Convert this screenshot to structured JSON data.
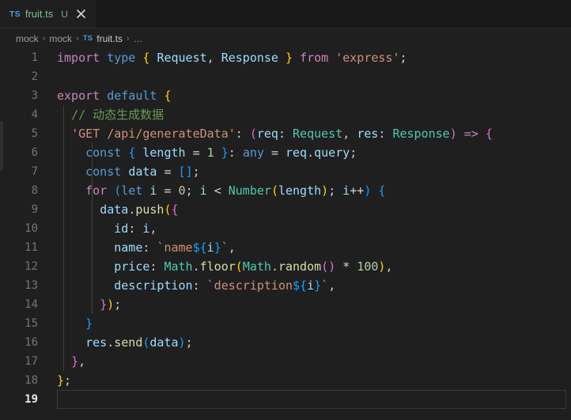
{
  "tab": {
    "file_type_badge": "TS",
    "label": "fruit.ts",
    "dirty_indicator": "U",
    "close_icon": "close-icon"
  },
  "breadcrumb": {
    "items": [
      "mock",
      "mock"
    ],
    "separator": "›",
    "file_badge": "TS",
    "file": "fruit.ts",
    "overflow": "…"
  },
  "editor": {
    "language": "typescript",
    "active_line": 19,
    "total_lines": 19,
    "line_numbers": [
      "1",
      "2",
      "3",
      "4",
      "5",
      "6",
      "7",
      "8",
      "9",
      "10",
      "11",
      "12",
      "13",
      "14",
      "15",
      "16",
      "17",
      "18",
      "19"
    ],
    "lines_text": [
      "import type { Request, Response } from 'express';",
      "",
      "export default {",
      "  // 动态生成数据",
      "  'GET /api/generateData': (req: Request, res: Response) => {",
      "    const { length = 1 }: any = req.query;",
      "    const data = [];",
      "    for (let i = 0; i < Number(length); i++) {",
      "      data.push({",
      "        id: i,",
      "        name: `name${i}`,",
      "        price: Math.floor(Math.random() * 100),",
      "        description: `description${i}`,",
      "      });",
      "    }",
      "    res.send(data);",
      "  },",
      "};",
      ""
    ],
    "tokens": {
      "l1": [
        "import",
        " ",
        "type",
        " ",
        "{",
        " ",
        "Request",
        ",",
        " ",
        "Response",
        " ",
        "}",
        " ",
        "from",
        " ",
        "'express'",
        ";"
      ],
      "l3": [
        "export",
        " ",
        "default",
        " ",
        "{"
      ],
      "l4": [
        "// 动态生成数据"
      ],
      "l5": [
        "'GET /api/generateData'",
        ":",
        " ",
        "(",
        "req",
        ":",
        " ",
        "Request",
        ",",
        " ",
        "res",
        ":",
        " ",
        "Response",
        ")",
        " ",
        "=>",
        " ",
        "{"
      ],
      "l6": [
        "const",
        " ",
        "{",
        " ",
        "length",
        " ",
        "=",
        " ",
        "1",
        " ",
        "}",
        ":",
        " ",
        "any",
        " ",
        "=",
        " ",
        "req",
        ".",
        "query",
        ";"
      ],
      "l7": [
        "const",
        " ",
        "data",
        " ",
        "=",
        " ",
        "[",
        "]",
        ";"
      ],
      "l8": [
        "for",
        " ",
        "(",
        "let",
        " ",
        "i",
        " ",
        "=",
        " ",
        "0",
        ";",
        " ",
        "i",
        " ",
        "<",
        " ",
        "Number",
        "(",
        "length",
        ")",
        ";",
        " ",
        "i",
        "++",
        ")",
        " ",
        "{"
      ],
      "l9": [
        "data",
        ".",
        "push",
        "(",
        "{"
      ],
      "l10": [
        "id",
        ":",
        " ",
        "i",
        ","
      ],
      "l11": [
        "name",
        ":",
        " ",
        "`name",
        "${",
        "i",
        "}",
        "`",
        ","
      ],
      "l12": [
        "price",
        ":",
        " ",
        "Math",
        ".",
        "floor",
        "(",
        "Math",
        ".",
        "random",
        "(",
        ")",
        " ",
        "*",
        " ",
        "100",
        ")",
        ","
      ],
      "l13": [
        "description",
        ":",
        " ",
        "`description",
        "${",
        "i",
        "}",
        "`",
        ","
      ],
      "l14": [
        "}",
        ")",
        ";"
      ],
      "l15": [
        "}"
      ],
      "l16": [
        "res",
        ".",
        "send",
        "(",
        "data",
        ")",
        ";"
      ],
      "l17": [
        "}",
        ","
      ],
      "l18": [
        "}",
        ";"
      ]
    }
  },
  "colors": {
    "background": "#1f1f1f",
    "tabbar_background": "#181818",
    "line_number": "#6e7681",
    "keyword_pink": "#c586c0",
    "keyword_blue": "#569cd6",
    "type_green": "#4ec9b0",
    "variable_blue": "#9cdcfe",
    "function_yellow": "#dcdcaa",
    "string_orange": "#ce9178",
    "number_green": "#b5cea8",
    "comment_green": "#6a9955",
    "bracket_yellow": "#ffd700",
    "bracket_purple": "#da70d6",
    "bracket_blue": "#179fff",
    "tab_label_green": "#7fbe8f",
    "ts_badge_blue": "#4a9bd1"
  }
}
